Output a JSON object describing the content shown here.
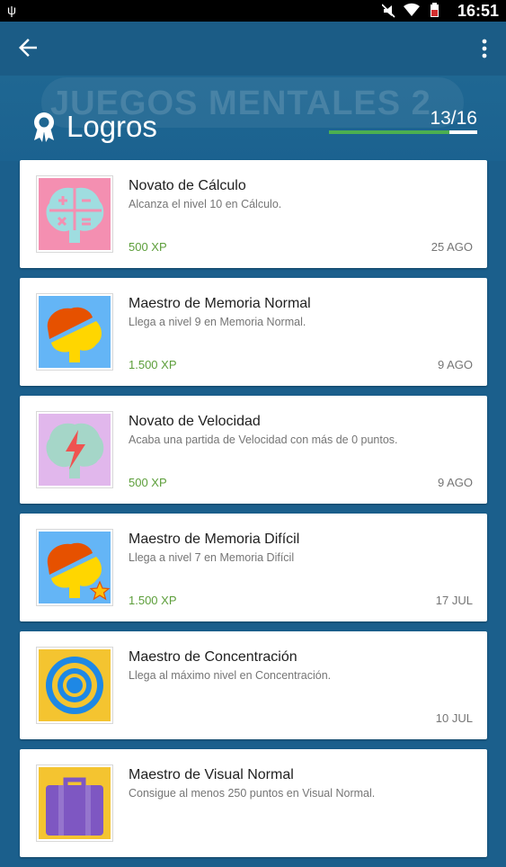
{
  "status_bar": {
    "time": "16:51",
    "icons": [
      "usb-icon",
      "mute-icon",
      "wifi-icon",
      "battery-icon"
    ]
  },
  "app_bar": {
    "back_icon": "arrow-back-icon",
    "menu_icon": "more-vert-icon"
  },
  "header": {
    "background_title": "JUEGOS MENTALES 2",
    "title": "Logros",
    "icon": "award-ribbon-icon",
    "progress_text": "13/16",
    "progress": {
      "completed": 13,
      "total": 16
    }
  },
  "achievements": [
    {
      "name": "Novato de Cálculo",
      "description": "Alcanza el nivel 10 en Cálculo.",
      "xp": "500 XP",
      "date": "25 AGO",
      "icon": "brain-math-icon"
    },
    {
      "name": "Maestro de Memoria Normal",
      "description": "Llega a nivel 9 en Memoria Normal.",
      "xp": "1.500 XP",
      "date": "9 AGO",
      "icon": "brain-memory-icon"
    },
    {
      "name": "Novato de Velocidad",
      "description": "Acaba una partida de Velocidad con más de 0 puntos.",
      "xp": "500 XP",
      "date": "9 AGO",
      "icon": "brain-lightning-icon"
    },
    {
      "name": "Maestro de Memoria Difícil",
      "description": "Llega a nivel 7 en Memoria Difícil",
      "xp": "1.500 XP",
      "date": "17 JUL",
      "icon": "brain-memory-star-icon"
    },
    {
      "name": "Maestro de Concentración",
      "description": "Llega al máximo nivel en Concentración.",
      "xp": "",
      "date": "10 JUL",
      "icon": "target-icon"
    },
    {
      "name": "Maestro de Visual Normal",
      "description": "Consigue al menos 250 puntos en Visual Normal.",
      "xp": "",
      "date": "",
      "icon": "briefcase-icon"
    }
  ],
  "colors": {
    "background": "#1b5f8c",
    "app_bar": "#1b5c86",
    "progress_fill": "#4caf50",
    "xp_text": "#5c9e3a"
  }
}
